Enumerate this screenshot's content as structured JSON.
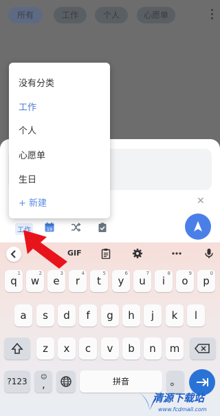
{
  "filter_tabs": [
    {
      "label": "所有",
      "active": true
    },
    {
      "label": "工作",
      "active": false
    },
    {
      "label": "个人",
      "active": false
    },
    {
      "label": "心愿单",
      "active": false
    }
  ],
  "sheet": {
    "selected_category_chip": "工作",
    "calendar_icon_day": "19",
    "close_icon": "close-icon",
    "send_icon": "send-icon"
  },
  "category_dropdown": {
    "items": [
      "没有分类",
      "工作",
      "个人",
      "心愿单",
      "生日"
    ],
    "selected": "工作",
    "new_item": "+ 新建"
  },
  "keyboard_toolbar": {
    "gif": "GIF",
    "icons": [
      "chevron-left-icon",
      "clipboard-icon",
      "gear-icon",
      "more-icon",
      "mic-icon"
    ]
  },
  "keyboard": {
    "row1": [
      [
        "q",
        "1"
      ],
      [
        "w",
        "2"
      ],
      [
        "e",
        "3"
      ],
      [
        "r",
        "4"
      ],
      [
        "t",
        "5"
      ],
      [
        "y",
        "6"
      ],
      [
        "u",
        "7"
      ],
      [
        "i",
        "8"
      ],
      [
        "o",
        "9"
      ],
      [
        "p",
        "0"
      ]
    ],
    "row2": [
      "a",
      "s",
      "d",
      "f",
      "g",
      "h",
      "j",
      "k",
      "l"
    ],
    "row3": [
      "z",
      "x",
      "c",
      "v",
      "b",
      "n",
      "m"
    ],
    "numbers_key": "?123",
    "emoji_key": "☺",
    "comma_key": ",",
    "space_label": "拼音",
    "period_key": "。",
    "accent": "#2a73d6"
  },
  "watermark": {
    "title": "清源下载站",
    "url": "www.fcdmall.com"
  }
}
